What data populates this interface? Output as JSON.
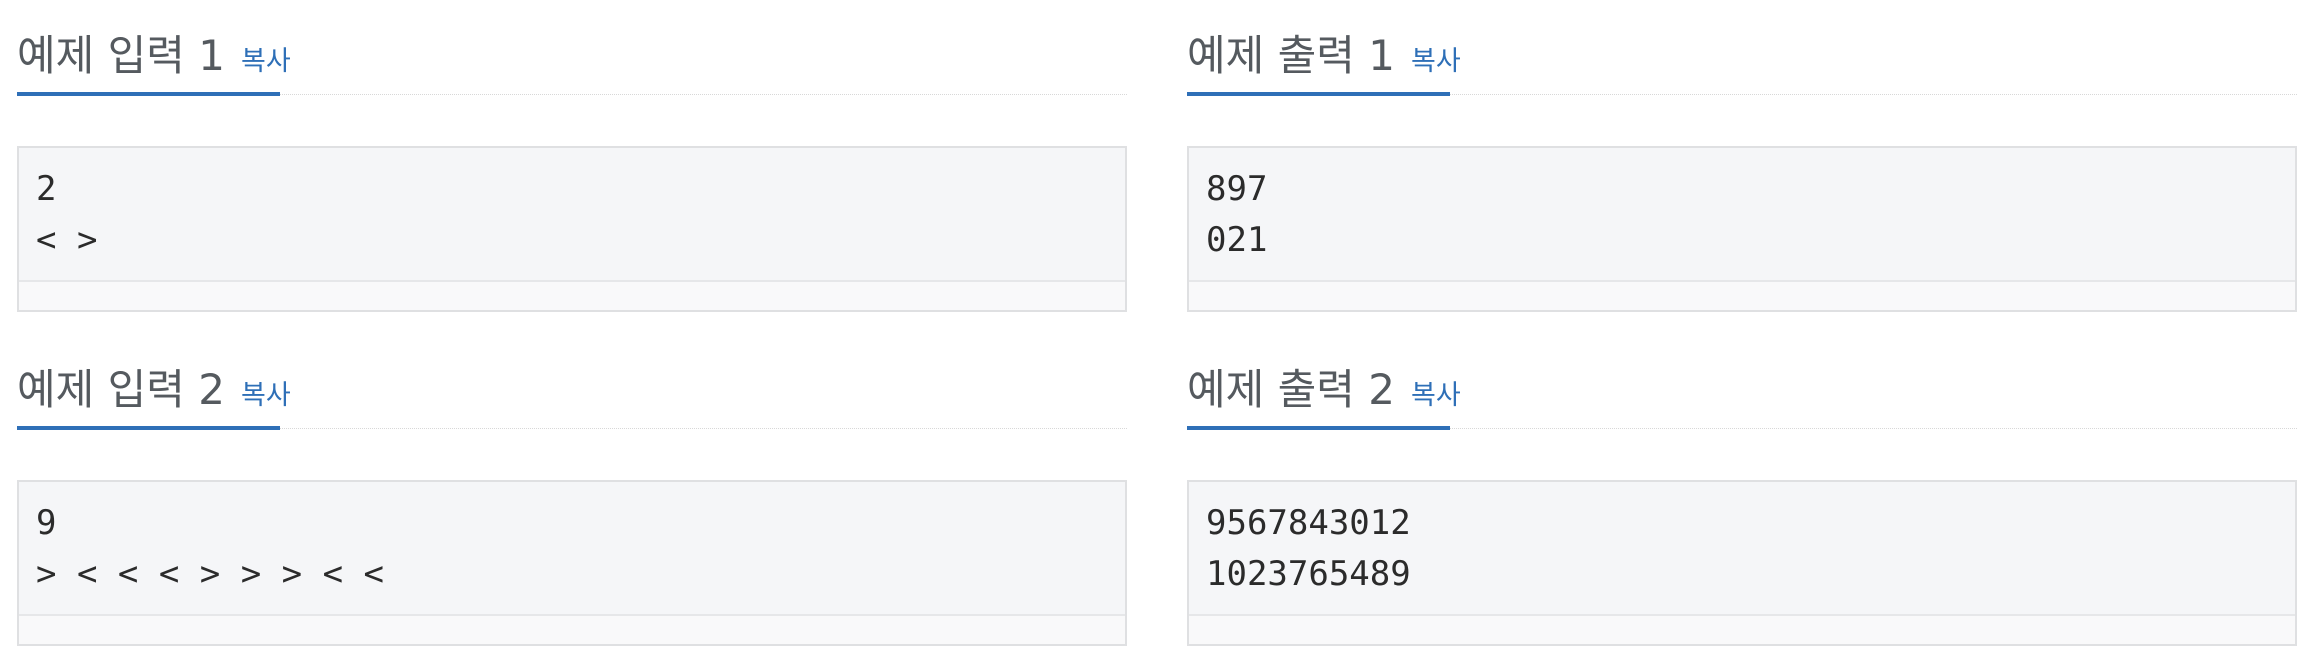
{
  "samples": {
    "input1": {
      "title": "예제 입력 1",
      "copy_label": "복사",
      "lines": [
        "2",
        "< >"
      ]
    },
    "output1": {
      "title": "예제 출력 1",
      "copy_label": "복사",
      "lines": [
        "897",
        "021"
      ]
    },
    "input2": {
      "title": "예제 입력 2",
      "copy_label": "복사",
      "lines": [
        "9",
        "> < < < > > > < <"
      ]
    },
    "output2": {
      "title": "예제 출력 2",
      "copy_label": "복사",
      "lines": [
        "9567843012",
        "1023765489"
      ]
    }
  },
  "colors": {
    "accent": "#2e6fb7",
    "heading": "#555a5f",
    "code_bg": "#f5f6f8",
    "code_border": "#dfe0e2"
  }
}
